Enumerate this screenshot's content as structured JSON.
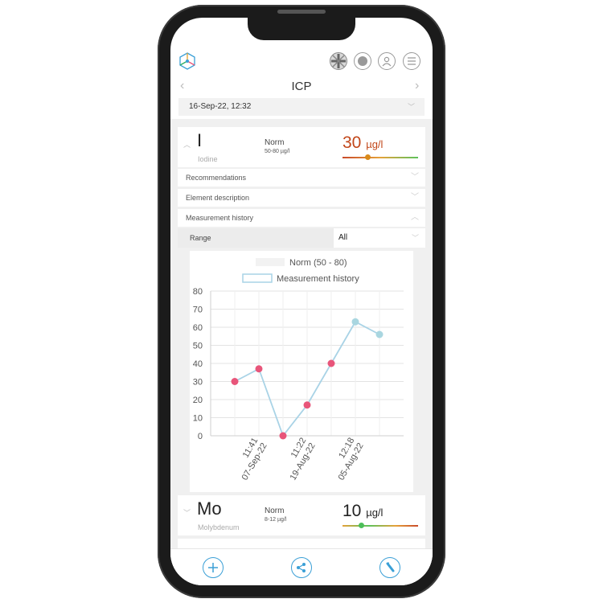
{
  "header": {
    "title": "ICP",
    "date": "16-Sep-22, 12:32"
  },
  "elements": [
    {
      "symbol": "I",
      "name": "Iodine",
      "norm_label": "Norm",
      "norm_range": "50-80 µg/l",
      "value": "30",
      "unit": "µg/l",
      "value_color": "#c2471a",
      "marker_fraction": 0.35
    },
    {
      "symbol": "Mo",
      "name": "Molybdenum",
      "norm_label": "Norm",
      "norm_range": "8-12 µg/l",
      "value": "10",
      "unit": "µg/l",
      "value_color": "#222222",
      "marker_fraction": 0.25
    }
  ],
  "sections": {
    "recommendations": "Recommendations",
    "description": "Element description",
    "history": "Measurement history"
  },
  "range": {
    "label": "Range",
    "selected": "All"
  },
  "chart_data": {
    "type": "line",
    "legend": [
      "Norm (50 - 80)",
      "Measurement history"
    ],
    "ylim": [
      0,
      80
    ],
    "yticks": [
      0,
      10,
      20,
      30,
      40,
      50,
      60,
      70,
      80
    ],
    "points": [
      {
        "y": 30,
        "status": "low"
      },
      {
        "y": 37,
        "status": "low"
      },
      {
        "y": 0,
        "status": "low"
      },
      {
        "y": 17,
        "status": "low"
      },
      {
        "y": 40,
        "status": "low"
      },
      {
        "y": 63,
        "status": "normal"
      },
      {
        "y": 56,
        "status": "normal"
      }
    ],
    "xtick_labels": [
      {
        "index": 1,
        "time": "11:41",
        "date": "07-Sep-22"
      },
      {
        "index": 3,
        "time": "11:22",
        "date": "19-Aug-22"
      },
      {
        "index": 5,
        "time": "12:18",
        "date": "05-Aug-22"
      }
    ],
    "colors": {
      "line": "#a9d3e6",
      "low": "#e8557a",
      "normal": "#a9d6e0",
      "grid": "#e3e3e3",
      "legend_norm": "#f2f2f2"
    }
  },
  "colors": {
    "accent": "#3a9fd6"
  }
}
